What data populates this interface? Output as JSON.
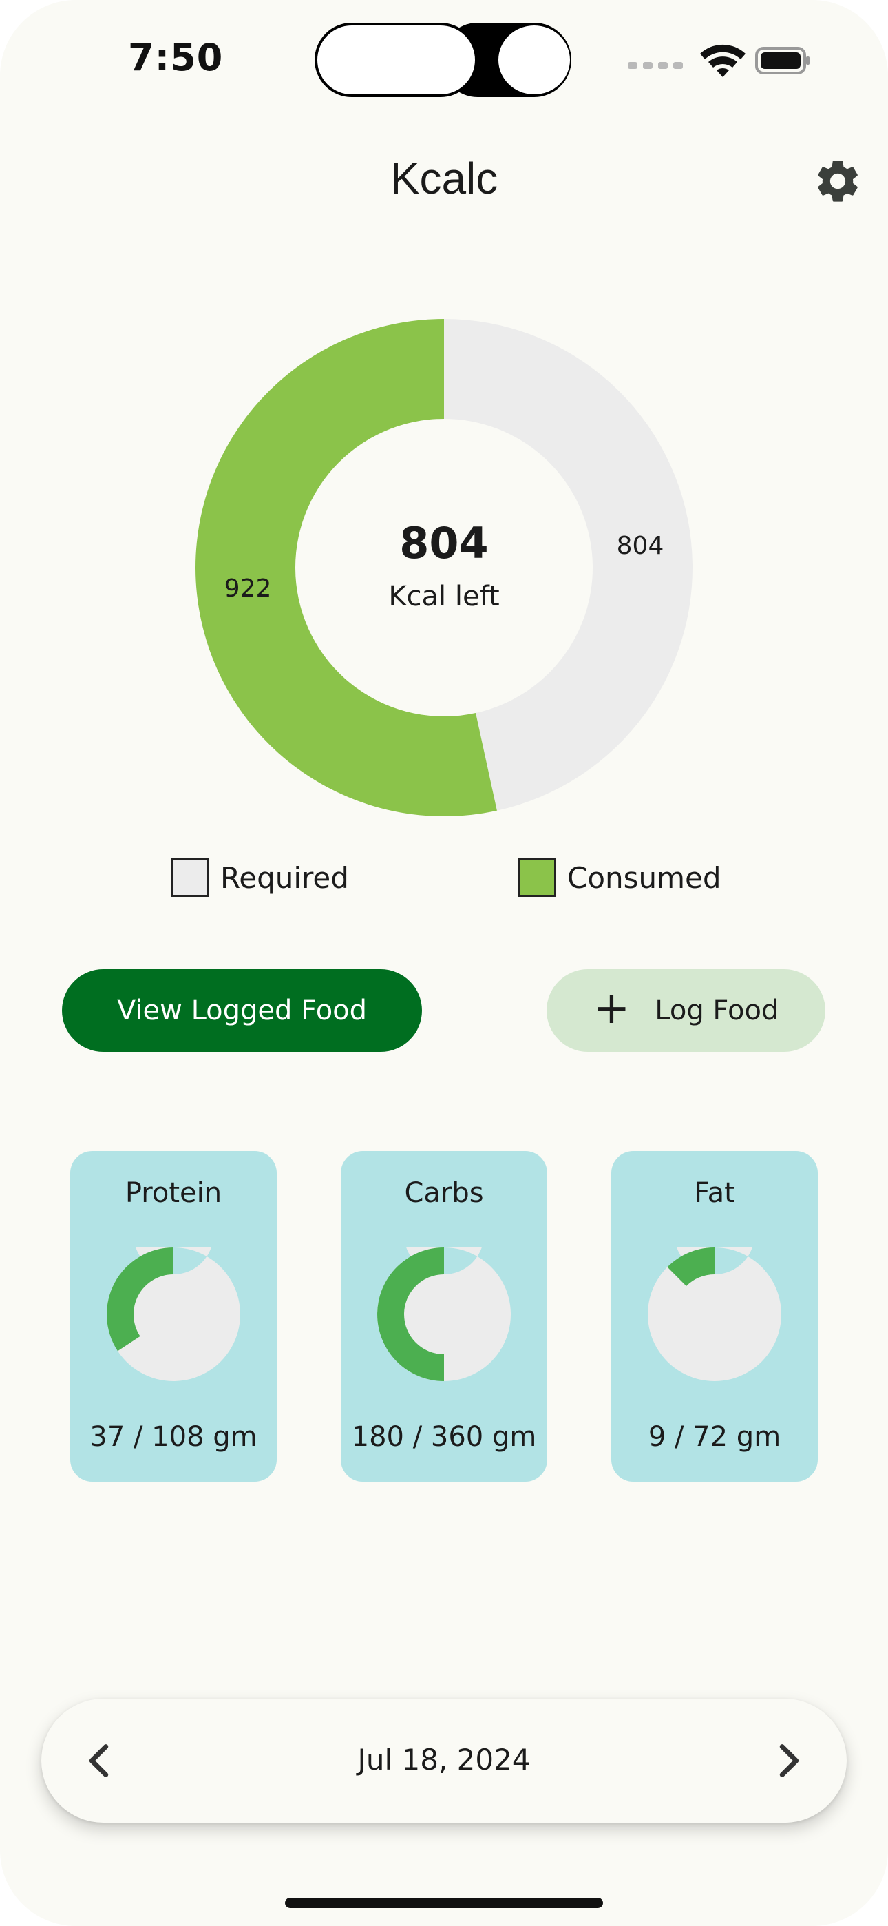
{
  "status_bar": {
    "time": "7:50"
  },
  "header": {
    "title": "Kcalc",
    "settings_icon": "gear-icon"
  },
  "summary": {
    "kcal_left": "804",
    "kcal_left_label": "Kcal left",
    "consumed_label": "922",
    "required_label": "804",
    "consumed_value": 922,
    "required_value": 804,
    "colors": {
      "consumed": "#8bc34a",
      "required": "#ececec"
    }
  },
  "legend": [
    {
      "label": "Required",
      "color": "#ececec"
    },
    {
      "label": "Consumed",
      "color": "#8bc34a"
    }
  ],
  "actions": {
    "view_logged_food": "View Logged Food",
    "log_food": "Log Food",
    "log_food_icon": "plus-icon"
  },
  "macros": [
    {
      "name": "Protein",
      "text": "37 / 108 gm",
      "consumed": 37,
      "target": 108
    },
    {
      "name": "Carbs",
      "text": "180 / 360 gm",
      "consumed": 180,
      "target": 360
    },
    {
      "name": "Fat",
      "text": "9 / 72 gm",
      "consumed": 9,
      "target": 72
    }
  ],
  "macro_colors": {
    "consumed": "#4caf50",
    "remaining": "#ececec",
    "card": "#b2e3e5"
  },
  "date_nav": {
    "date": "Jul 18, 2024",
    "prev_icon": "chevron-left-icon",
    "next_icon": "chevron-right-icon"
  }
}
